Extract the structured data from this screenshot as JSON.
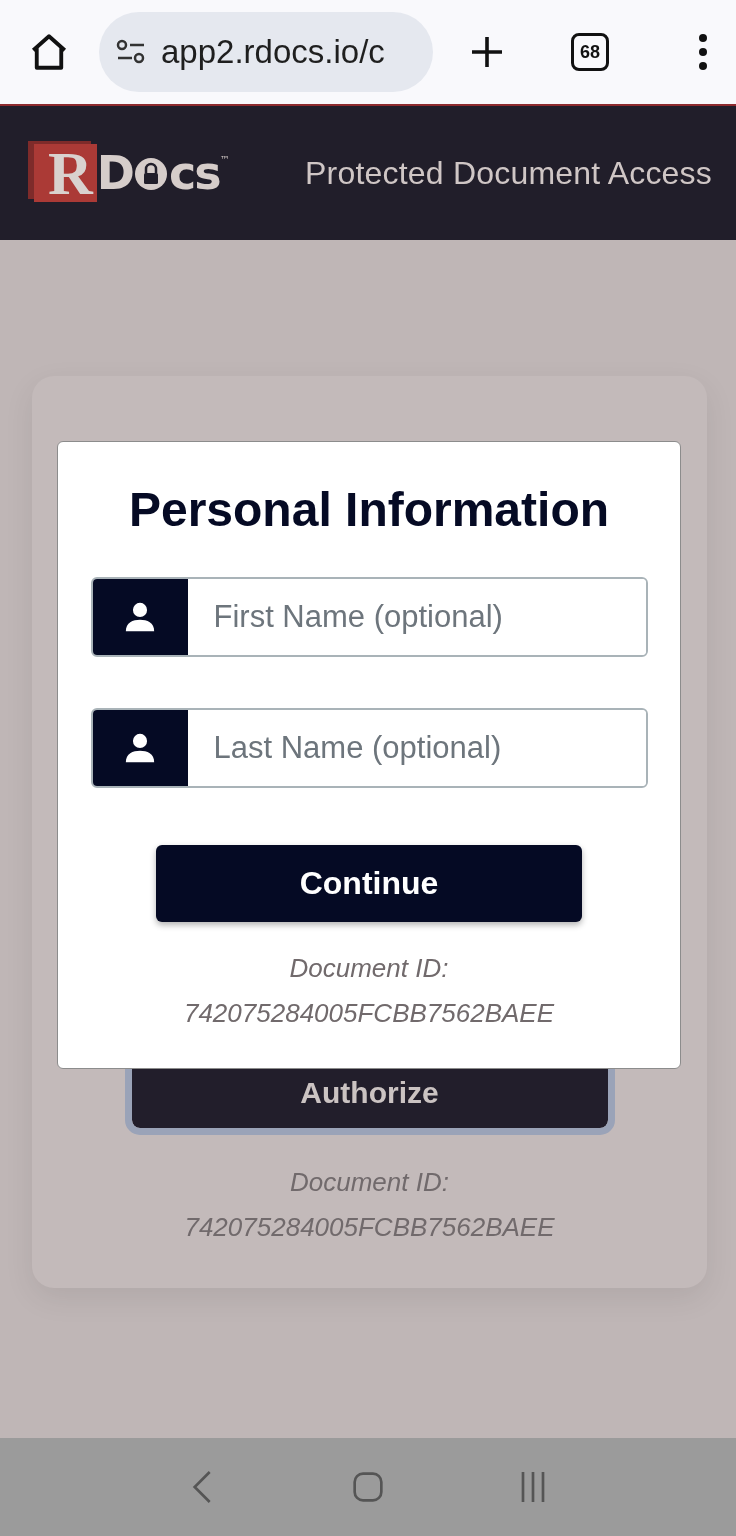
{
  "browser": {
    "url": "app2.rdocs.io/c",
    "tab_count": "68"
  },
  "header": {
    "logo": {
      "initial": "R",
      "before_lock": "D",
      "after_lock": "cs",
      "trademark": "™"
    },
    "title": "Protected Document Access"
  },
  "background_card": {
    "button": "Authorize",
    "document_id_label": "Document ID:",
    "document_id": "742075284005FCBB7562BAEE"
  },
  "modal": {
    "title": "Personal Information",
    "fields": [
      {
        "placeholder": "First Name (optional)"
      },
      {
        "placeholder": "Last Name (optional)"
      }
    ],
    "button": "Continue",
    "document_id_label": "Document ID:",
    "document_id": "742075284005FCBB7562BAEE"
  }
}
